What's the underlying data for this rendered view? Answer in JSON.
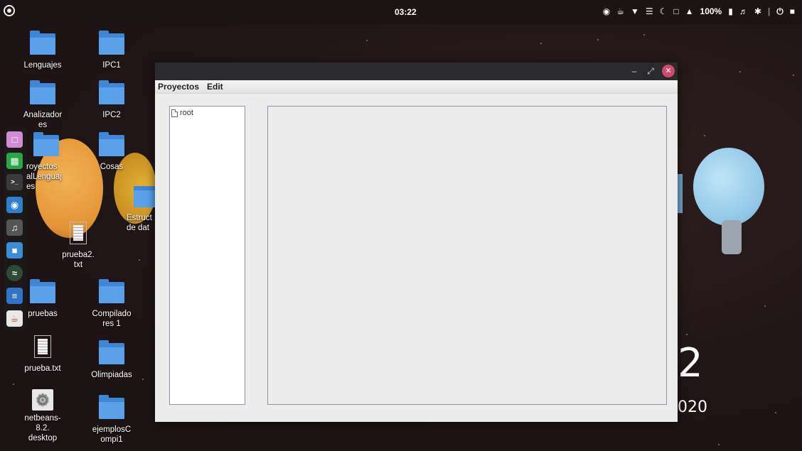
{
  "topbar": {
    "clock": "03:22",
    "battery_text": "100%",
    "icons": [
      "discord-icon",
      "coffee-icon",
      "wifi-icon",
      "menu-icon",
      "night-icon",
      "clipboard-icon",
      "notification-icon",
      "battery-icon",
      "volume-icon",
      "bluetooth-icon",
      "power-icon",
      "exit-icon"
    ]
  },
  "desktop": {
    "icons": [
      {
        "label": "Lenguajes",
        "type": "folder"
      },
      {
        "label": "IPC1",
        "type": "folder"
      },
      {
        "label": "Analizador\nes",
        "type": "folder"
      },
      {
        "label": "IPC2",
        "type": "folder"
      },
      {
        "label": "royectos\nalLenguaj\nes",
        "type": "folder"
      },
      {
        "label": "Cosas",
        "type": "folder"
      },
      {
        "label": "Estruct\nde dat",
        "type": "folder"
      },
      {
        "label": "prueba2.\ntxt",
        "type": "text"
      },
      {
        "label": "pruebas",
        "type": "folder"
      },
      {
        "label": "Compilado\nres 1",
        "type": "folder"
      },
      {
        "label": "prueba.txt",
        "type": "text"
      },
      {
        "label": "Olimpiadas",
        "type": "folder"
      },
      {
        "label": "netbeans-\n8.2.\ndesktop",
        "type": "desktop-file"
      },
      {
        "label": "ejemplosC\nompi1",
        "type": "folder"
      }
    ],
    "clock_widget": {
      "digit": "2",
      "year_fragment": "020"
    }
  },
  "dock": {
    "apps": [
      "files-icon",
      "spreadsheet-icon",
      "terminal-icon",
      "browser-icon",
      "music-icon",
      "box-icon",
      "spotify-icon",
      "text-editor-icon",
      "java-icon"
    ]
  },
  "window": {
    "menus": [
      "Proyectos",
      "Edit"
    ],
    "tree": {
      "root_label": "root"
    },
    "controls": [
      "minimize-icon",
      "maximize-icon",
      "close-icon"
    ]
  }
}
